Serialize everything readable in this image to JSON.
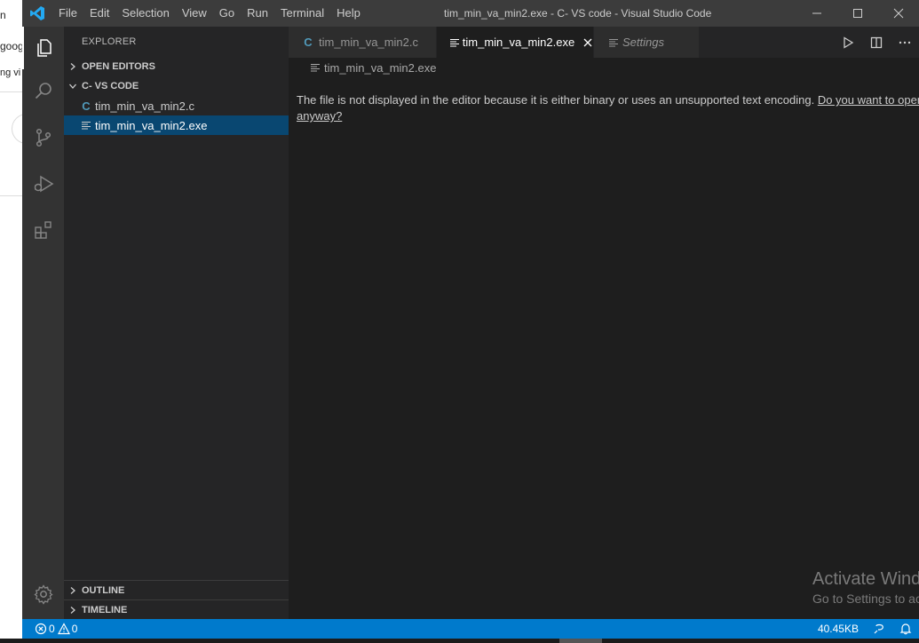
{
  "background_app": {
    "snippets": [
      "n",
      "goog",
      "ng vi"
    ]
  },
  "titlebar": {
    "menu": [
      "File",
      "Edit",
      "Selection",
      "View",
      "Go",
      "Run",
      "Terminal",
      "Help"
    ],
    "title": "tim_min_va_min2.exe - C- VS code - Visual Studio Code"
  },
  "sidebar": {
    "title": "EXPLORER",
    "open_editors": "OPEN EDITORS",
    "folder": "C- VS CODE",
    "files": [
      {
        "name": "tim_min_va_min2.c",
        "icon": "C"
      },
      {
        "name": "tim_min_va_min2.exe",
        "icon": "file-lines-icon"
      }
    ],
    "outline": "OUTLINE",
    "timeline": "TIMELINE"
  },
  "tabs": [
    {
      "label": "tim_min_va_min2.c",
      "icon": "C"
    },
    {
      "label": "tim_min_va_min2.exe",
      "icon": "file-lines-icon"
    },
    {
      "label": "Settings",
      "icon": "file-lines-icon"
    }
  ],
  "breadcrumb": "tim_min_va_min2.exe",
  "editor": {
    "message": "The file is not displayed in the editor because it is either binary or uses an unsupported text encoding.",
    "link": "Do you want to open it anyway?"
  },
  "watermark": {
    "line1": "Activate Windows",
    "line2": "Go to Settings to activate Windows."
  },
  "statusbar": {
    "errors": "0",
    "warnings": "0",
    "filesize": "40.45KB"
  },
  "colors": {
    "accent": "#007acc",
    "selection": "#094771",
    "c_icon": "#519aba"
  }
}
